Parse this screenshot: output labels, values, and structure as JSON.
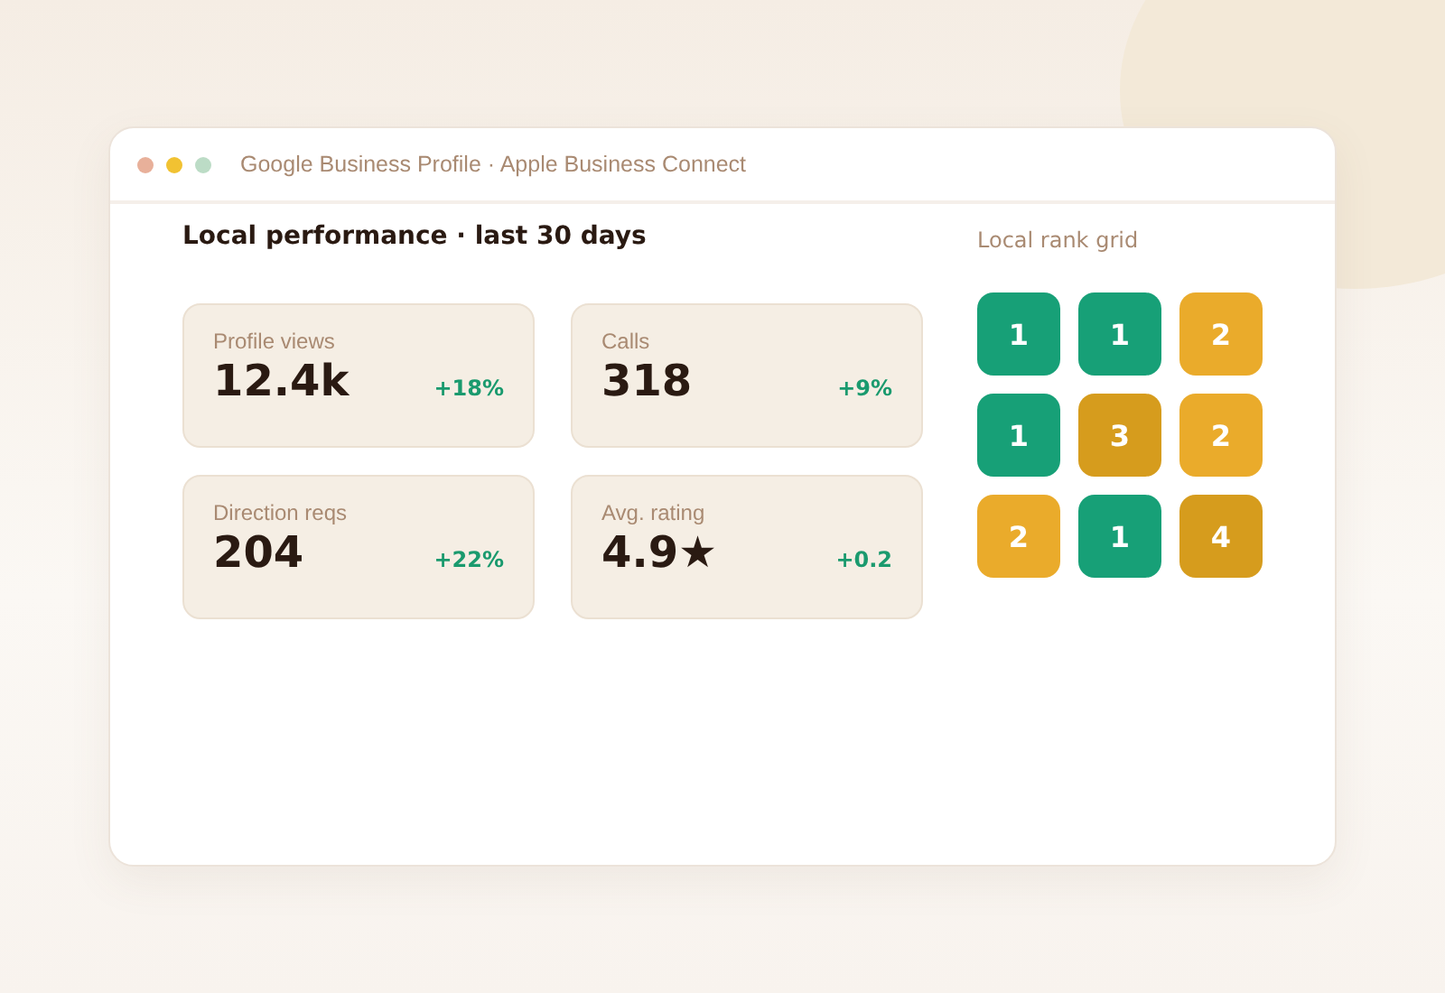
{
  "window": {
    "title": "Google Business Profile · Apple Business Connect"
  },
  "heading": "Local performance · last 30 days",
  "metrics": [
    {
      "label": "Profile views",
      "value": "12.4k",
      "change": "+18%"
    },
    {
      "label": "Calls",
      "value": "318",
      "change": "+9%"
    },
    {
      "label": "Direction reqs",
      "value": "204",
      "change": "+22%"
    },
    {
      "label": "Avg. rating",
      "value": "4.9★",
      "change": "+0.2"
    }
  ],
  "rank_grid": {
    "title": "Local rank grid",
    "cells": [
      {
        "rank": "1",
        "color": "#17a077"
      },
      {
        "rank": "1",
        "color": "#17a077"
      },
      {
        "rank": "2",
        "color": "#eaab2b"
      },
      {
        "rank": "1",
        "color": "#17a077"
      },
      {
        "rank": "3",
        "color": "#d69c1d"
      },
      {
        "rank": "2",
        "color": "#eaab2b"
      },
      {
        "rank": "2",
        "color": "#eaab2b"
      },
      {
        "rank": "1",
        "color": "#17a077"
      },
      {
        "rank": "4",
        "color": "#d69c1d"
      }
    ]
  }
}
